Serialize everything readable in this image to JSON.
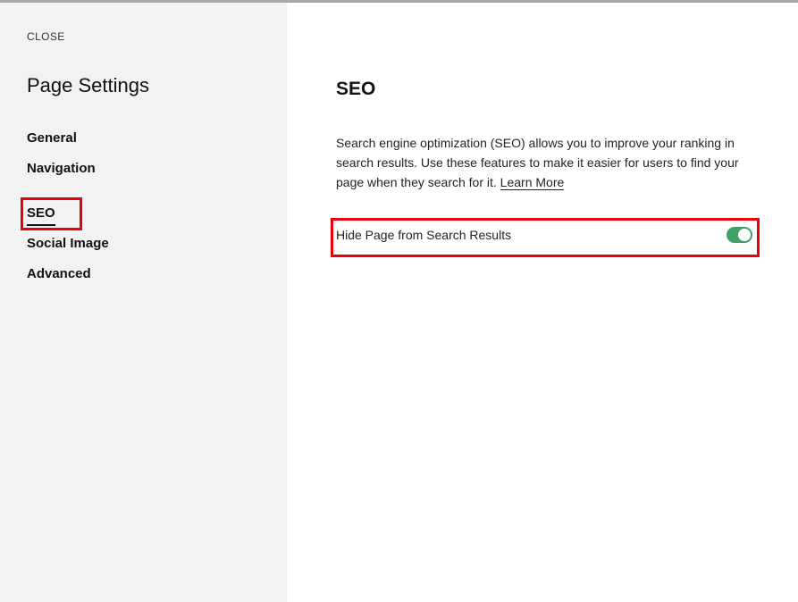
{
  "sidebar": {
    "close_label": "CLOSE",
    "title": "Page Settings",
    "items": [
      {
        "label": "General"
      },
      {
        "label": "Navigation"
      },
      {
        "label": "SEO",
        "active": true
      },
      {
        "label": "Social Image"
      },
      {
        "label": "Advanced"
      }
    ]
  },
  "main": {
    "title": "SEO",
    "description": "Search engine optimization (SEO) allows you to improve your ranking in search results. Use these features to make it easier for users to find your page when they search for it.",
    "learn_more_label": "Learn More",
    "toggle_label": "Hide Page from Search Results",
    "toggle_on": true
  },
  "colors": {
    "sidebar_bg": "#f2f2f2",
    "highlight": "#e8000d",
    "toggle_on": "#3fa069"
  }
}
